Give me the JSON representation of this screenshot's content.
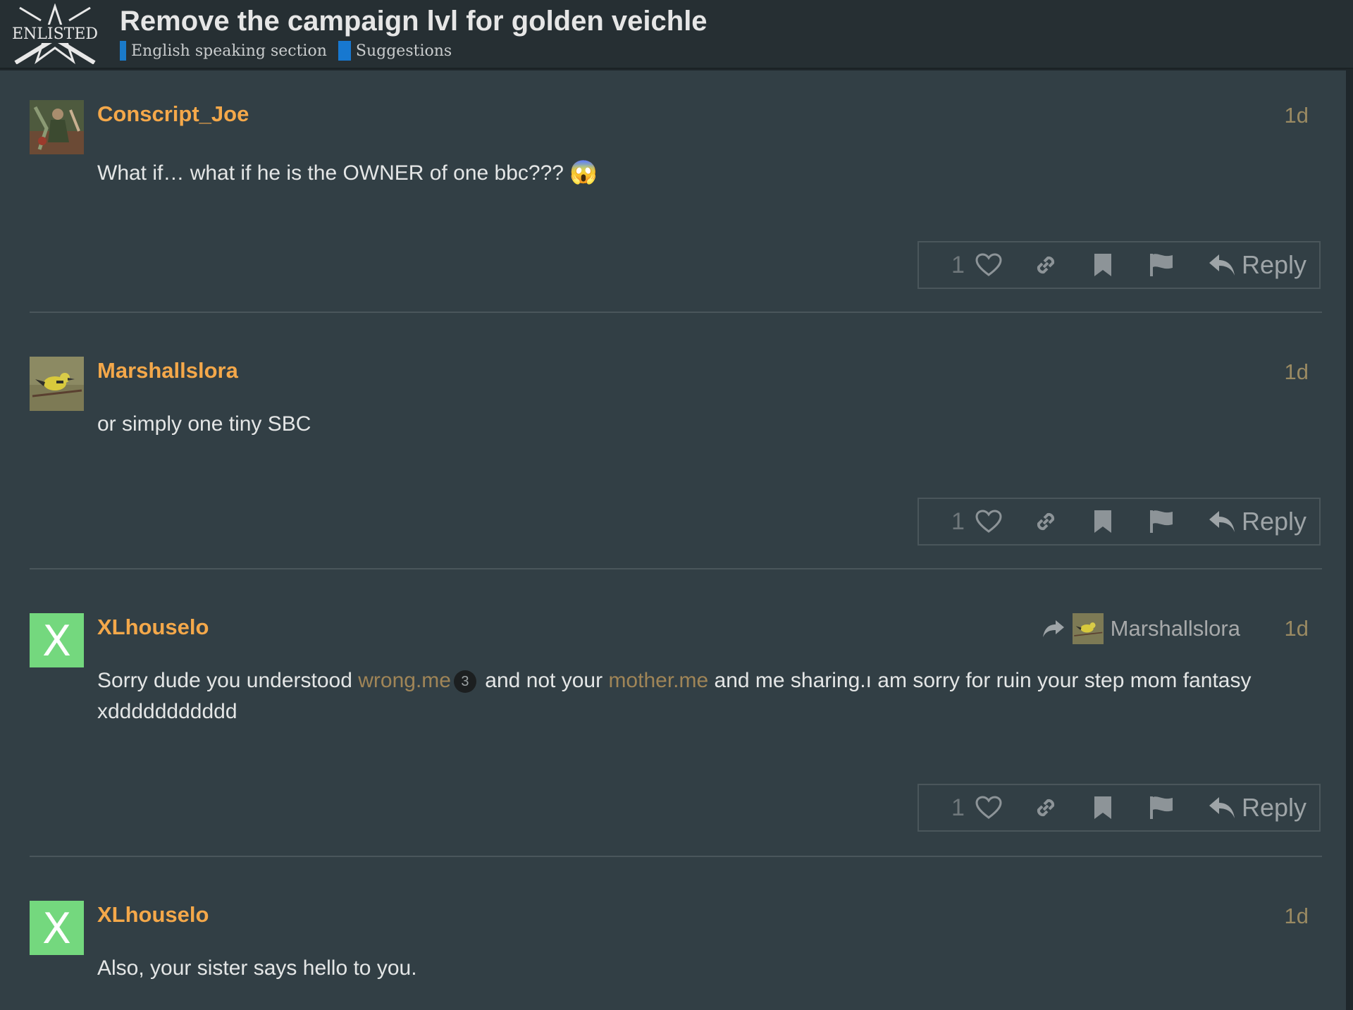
{
  "header": {
    "logo_text": "ENLISTED",
    "title": "Remove the campaign lvl for golden veichle",
    "breadcrumbs": [
      {
        "label": "English speaking section",
        "color": "#1a7ac9"
      },
      {
        "label": "Suggestions",
        "color": "#1778d0"
      }
    ]
  },
  "colors": {
    "username": "#f4a84a",
    "date": "#9a8a62",
    "link": "#a08557",
    "letter_avatar_bg": "#74d87e"
  },
  "posts": [
    {
      "username": "Conscript_Joe",
      "date": "1d",
      "body": "What if… what if he is the OWNER of one bbc???",
      "emoji": "😱",
      "avatar_icon": "soldier-art-avatar",
      "likes": "1",
      "reply_label": "Reply"
    },
    {
      "username": "Marshallslora",
      "date": "1d",
      "body": "or simply one tiny SBC",
      "avatar_icon": "bird-avatar",
      "likes": "1",
      "reply_label": "Reply"
    },
    {
      "username": "XLhouselo",
      "date": "1d",
      "avatar_letter": "X",
      "reply_to": "Marshallslora",
      "body_parts": {
        "p1": "Sorry dude you understood ",
        "link1": "wrong.me",
        "badge": "3",
        "p2": " and not your ",
        "link2": "mother.me",
        "p3": " and me sharing.ı am sorry for ruin your step mom fantasy xddddddddddd"
      },
      "likes": "1",
      "reply_label": "Reply"
    },
    {
      "username": "XLhouselo",
      "date": "1d",
      "avatar_letter": "X",
      "body": "Also, your sister says hello to you."
    }
  ]
}
